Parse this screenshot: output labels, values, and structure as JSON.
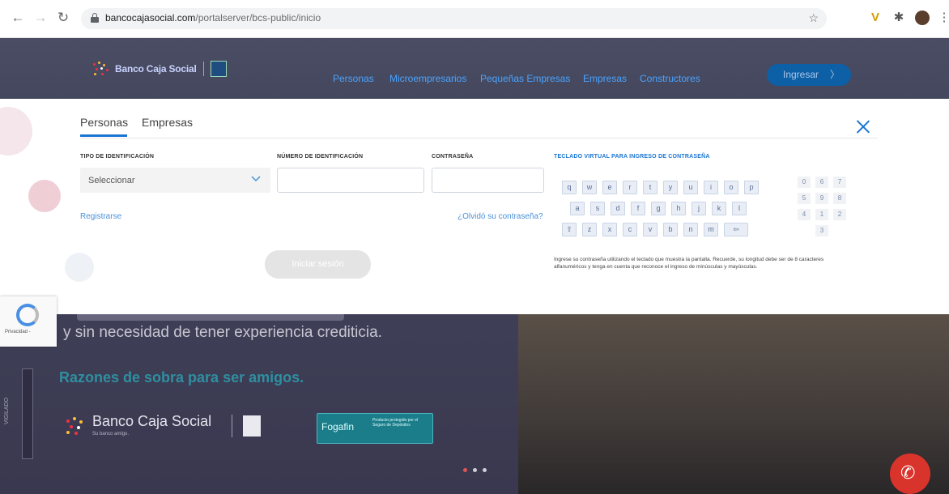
{
  "browser": {
    "url_domain": "bancocajasocial.com",
    "url_path": "/portalserver/bcs-public/inicio"
  },
  "header": {
    "logo_text": "Banco Caja Social",
    "nav": [
      "Personas",
      "Microempresarios",
      "Pequeñas Empresas",
      "Empresas",
      "Constructores"
    ],
    "login_button": "Ingresar"
  },
  "login_panel": {
    "tabs": [
      "Personas",
      "Empresas"
    ],
    "id_type_label": "TIPO DE IDENTIFICACIÓN",
    "id_type_value": "Seleccionar",
    "id_number_label": "NÚMERO DE IDENTIFICACIÓN",
    "password_label": "CONTRASEÑA",
    "register_link": "Registrarse",
    "forgot_link": "¿Olvidó su contraseña?",
    "submit_button": "Iniciar sesión",
    "virtual_keyboard": {
      "title": "TECLADO VIRTUAL PARA INGRESO DE CONTRASEÑA",
      "row1": [
        "q",
        "w",
        "e",
        "r",
        "t",
        "y",
        "u",
        "i",
        "o",
        "p"
      ],
      "row2": [
        "a",
        "s",
        "d",
        "f",
        "g",
        "h",
        "j",
        "k",
        "l"
      ],
      "row3": [
        "⇧",
        "z",
        "x",
        "c",
        "v",
        "b",
        "n",
        "m",
        "⇦"
      ],
      "numbers": [
        [
          "0",
          "6",
          "7"
        ],
        [
          "5",
          "9",
          "8"
        ],
        [
          "4",
          "1",
          "2"
        ],
        [
          "3"
        ]
      ],
      "help_text": "Ingrese su contraseña utilizando el teclado que muestra la pantalla. Recuerde, su longitud debe ser de 8 caracteres alfanuméricos y tenga en cuenta que reconoce el ingreso de minúsculas y mayúsculas."
    }
  },
  "hero": {
    "line2": "y sin necesidad de tener experiencia crediticia.",
    "reasons": "Razones de sobra para ser amigos.",
    "brand": "Banco Caja Social",
    "brand_tagline": "Su banco amigo.",
    "fogafin": "Fogafin",
    "fogafin_text": "Producto protegido por el Seguro de Depósitos",
    "vigilado": "VIGILADO"
  },
  "recaptcha_label": "Privacidad -"
}
